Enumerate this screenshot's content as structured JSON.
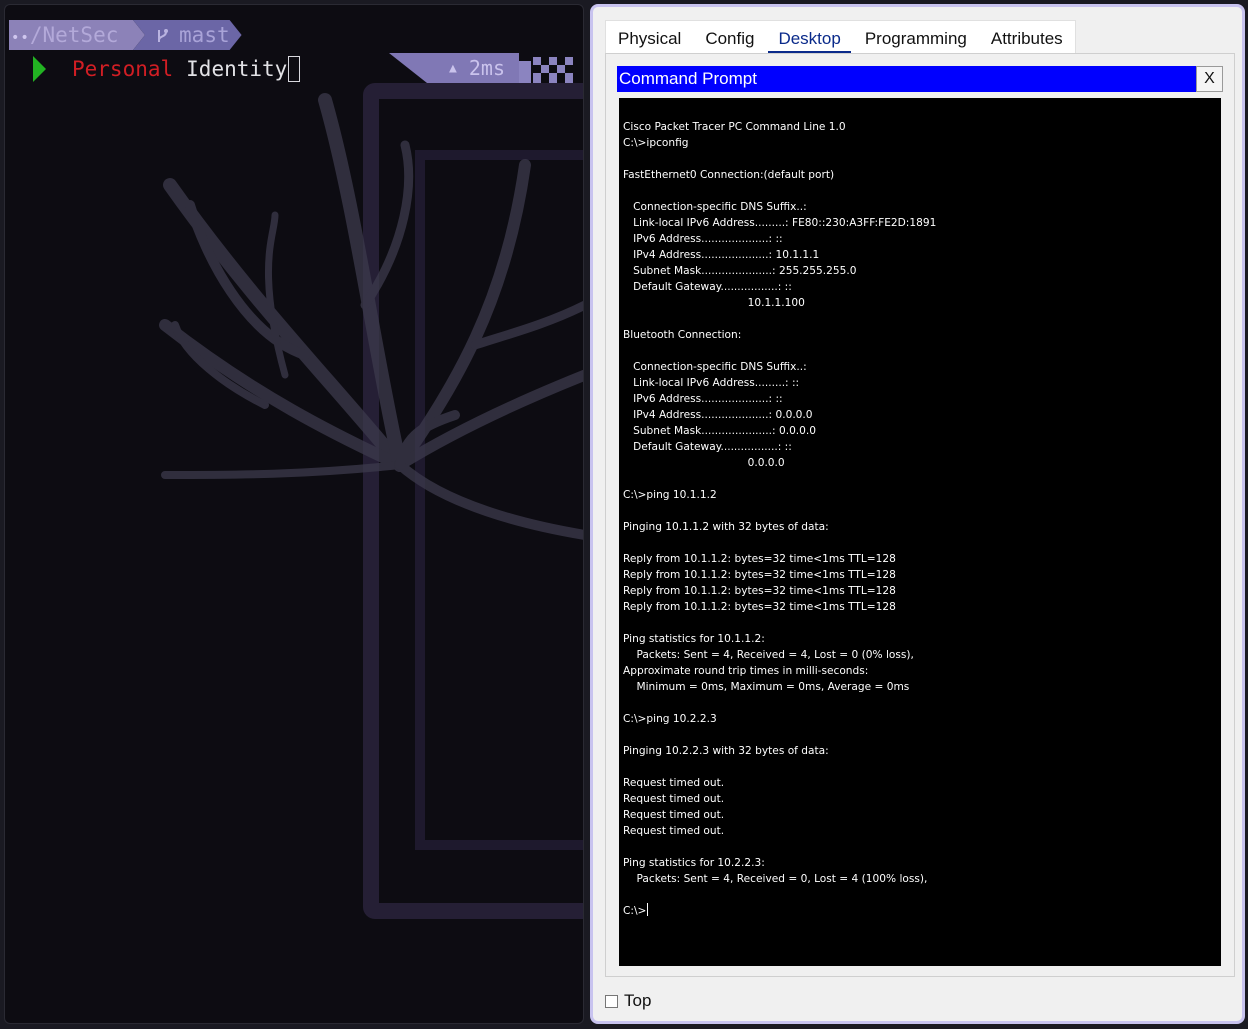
{
  "terminal": {
    "path_dots": "••",
    "path": "/NetSec",
    "branch_icon": "git-branch-icon",
    "branch": "mast",
    "prompt_word1": "Personal",
    "prompt_word2": "Identity",
    "timing_icon": "up-caret-icon",
    "timing": "2ms",
    "colors": {
      "path_bg": "#8c82b8",
      "branch_bg": "#6b66a6",
      "prompt_arrow": "#22b322",
      "word1": "#d11e24",
      "timing_bg": "#8078b5"
    }
  },
  "packet_tracer": {
    "tabs": [
      {
        "label": "Physical",
        "active": false
      },
      {
        "label": "Config",
        "active": false
      },
      {
        "label": "Desktop",
        "active": true
      },
      {
        "label": "Programming",
        "active": false
      },
      {
        "label": "Attributes",
        "active": false
      }
    ],
    "window_title": "Command Prompt",
    "close_label": "X",
    "title_bar_color": "#0000ff",
    "output_lines": [
      "Cisco Packet Tracer PC Command Line 1.0",
      "C:\\>ipconfig",
      "",
      "FastEthernet0 Connection:(default port)",
      "",
      "   Connection-specific DNS Suffix..:",
      "   Link-local IPv6 Address.........: FE80::230:A3FF:FE2D:1891",
      "   IPv6 Address....................: ::",
      "   IPv4 Address....................: 10.1.1.1",
      "   Subnet Mask.....................: 255.255.255.0",
      "   Default Gateway.................: ::",
      "                                     10.1.1.100",
      "",
      "Bluetooth Connection:",
      "",
      "   Connection-specific DNS Suffix..:",
      "   Link-local IPv6 Address.........: ::",
      "   IPv6 Address....................: ::",
      "   IPv4 Address....................: 0.0.0.0",
      "   Subnet Mask.....................: 0.0.0.0",
      "   Default Gateway.................: ::",
      "                                     0.0.0.0",
      "",
      "C:\\>ping 10.1.1.2",
      "",
      "Pinging 10.1.1.2 with 32 bytes of data:",
      "",
      "Reply from 10.1.1.2: bytes=32 time<1ms TTL=128",
      "Reply from 10.1.1.2: bytes=32 time<1ms TTL=128",
      "Reply from 10.1.1.2: bytes=32 time<1ms TTL=128",
      "Reply from 10.1.1.2: bytes=32 time<1ms TTL=128",
      "",
      "Ping statistics for 10.1.1.2:",
      "    Packets: Sent = 4, Received = 4, Lost = 0 (0% loss),",
      "Approximate round trip times in milli-seconds:",
      "    Minimum = 0ms, Maximum = 0ms, Average = 0ms",
      "",
      "C:\\>ping 10.2.2.3",
      "",
      "Pinging 10.2.2.3 with 32 bytes of data:",
      "",
      "Request timed out.",
      "Request timed out.",
      "Request timed out.",
      "Request timed out.",
      "",
      "Ping statistics for 10.2.2.3:",
      "    Packets: Sent = 4, Received = 0, Lost = 4 (100% loss),",
      ""
    ],
    "current_prompt": "C:\\>",
    "top_checkbox_label": "Top",
    "top_checked": false
  }
}
